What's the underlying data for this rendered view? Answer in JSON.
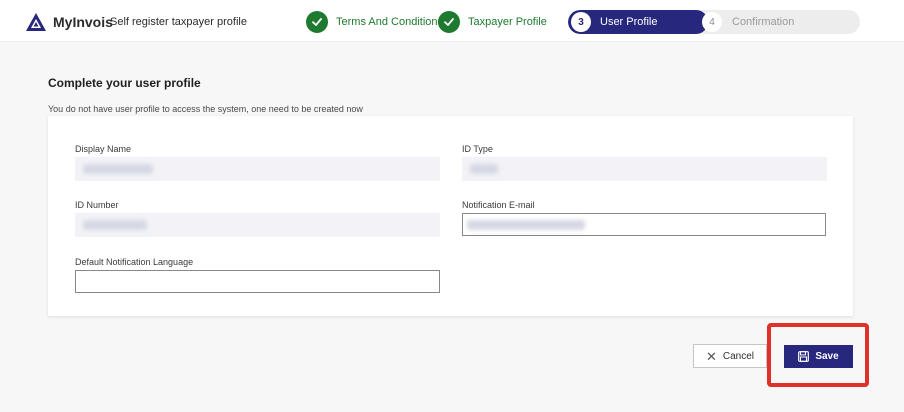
{
  "header": {
    "app_name": "MyInvois",
    "subtitle": "Self register taxpayer profile"
  },
  "stepper": {
    "steps": [
      {
        "label": "Terms And Conditions",
        "state": "done"
      },
      {
        "label": "Taxpayer Profile",
        "state": "done"
      },
      {
        "number": "3",
        "label": "User Profile",
        "state": "active"
      },
      {
        "number": "4",
        "label": "Confirmation",
        "state": "pending"
      }
    ]
  },
  "main": {
    "title": "Complete your user profile",
    "description": "You do not have user profile to access the system, one need to be created now"
  },
  "form": {
    "display_name_label": "Display Name",
    "id_type_label": "ID Type",
    "id_number_label": "ID Number",
    "notification_email_label": "Notification E-mail",
    "default_language_label": "Default Notification Language",
    "default_language_value": ""
  },
  "actions": {
    "cancel_label": "Cancel",
    "save_label": "Save"
  },
  "colors": {
    "brand": "#27277e",
    "success": "#1e7a2f",
    "highlight": "#e0302a"
  },
  "icons": {
    "logo": "myinvois-logo-icon",
    "check": "check-icon",
    "cancel": "close-icon",
    "save": "floppy-disk-icon"
  }
}
